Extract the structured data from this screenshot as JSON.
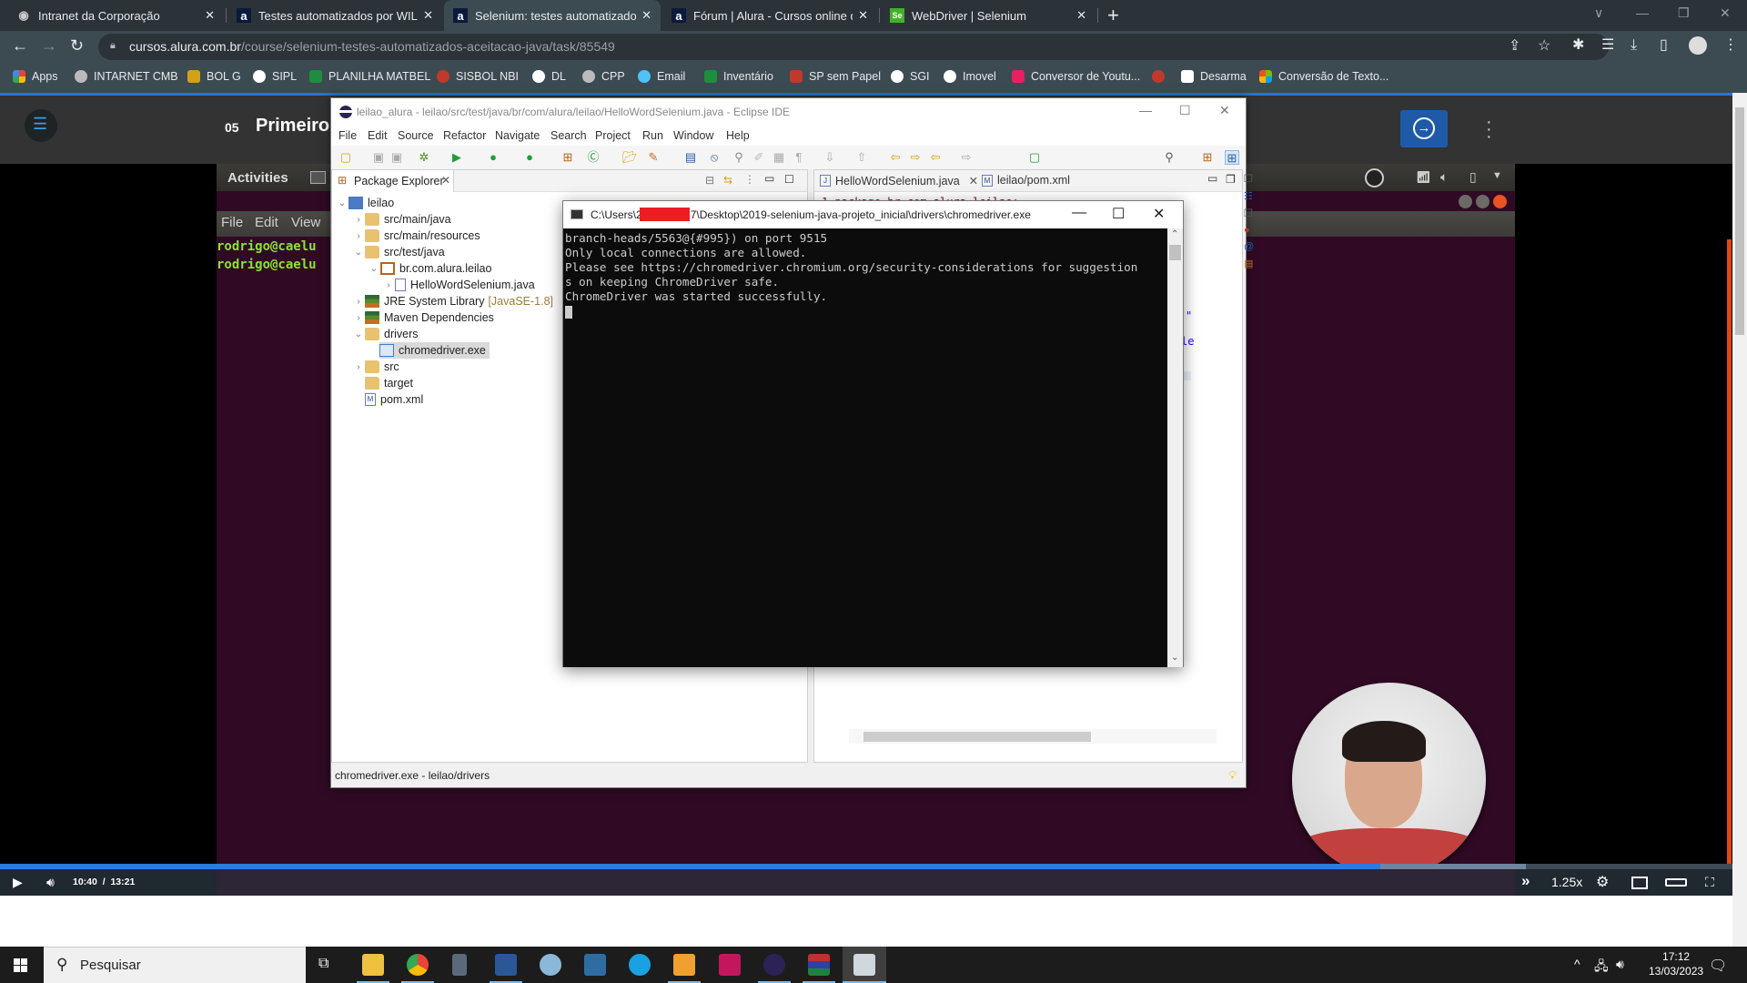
{
  "browser": {
    "tabs": [
      {
        "title": "Intranet da Corporação",
        "icon": "globe-icon"
      },
      {
        "title": "Testes automatizados por WILLIA",
        "icon": "alura-icon"
      },
      {
        "title": "Selenium: testes automatizados d",
        "icon": "alura-icon",
        "active": true
      },
      {
        "title": "Fórum | Alura - Cursos online de",
        "icon": "alura-icon"
      },
      {
        "title": "WebDriver | Selenium",
        "icon": "selenium-icon"
      }
    ],
    "url_host": "cursos.alura.com.br",
    "url_path": "/course/selenium-testes-automatizados-aceitacao-java/task/85549",
    "bookmarks": [
      {
        "label": "Apps",
        "color": "#f4b400"
      },
      {
        "label": "INTARNET CMB",
        "color": "#bbbbbb"
      },
      {
        "label": "BOL G",
        "color": "#d4a017"
      },
      {
        "label": "SIPL",
        "color": "#ffffff"
      },
      {
        "label": "PLANILHA MATBEL",
        "color": "#1e8e3e"
      },
      {
        "label": "SISBOL NBI",
        "color": "#c0392b"
      },
      {
        "label": "DL",
        "color": "#ffffff"
      },
      {
        "label": "CPP",
        "color": "#bbbbbb"
      },
      {
        "label": "Email",
        "color": "#4fc3f7"
      },
      {
        "label": "Inventário",
        "color": "#1e8e3e"
      },
      {
        "label": "SP sem Papel",
        "color": "#c0392b"
      },
      {
        "label": "SGI",
        "color": "#ffffff"
      },
      {
        "label": "Imovel",
        "color": "#ffffff"
      },
      {
        "label": "Conversor de Youtu...",
        "color": "#e91e63"
      },
      {
        "label": "",
        "color": "#c0392b"
      },
      {
        "label": "Desarma",
        "color": "#ffffff"
      },
      {
        "label": "Conversão de Texto...",
        "color": "#f25022"
      }
    ]
  },
  "alura": {
    "lesson_number": "05",
    "lesson_title": "Primeiro",
    "next_icon": "arrow-right-circle-icon",
    "more_icon": "kebab-icon",
    "menu_icon": "menu-arrow-icon"
  },
  "ubuntu": {
    "activities": "Activities",
    "menu": [
      "File",
      "Edit",
      "View"
    ],
    "prompt_lines": [
      "rodrigo@caelu",
      "rodrigo@caelu"
    ]
  },
  "eclipse": {
    "title": "leilao_alura - leilao/src/test/java/br/com/alura/leilao/HelloWordSelenium.java - Eclipse IDE",
    "menu": [
      "File",
      "Edit",
      "Source",
      "Refactor",
      "Navigate",
      "Search",
      "Project",
      "Run",
      "Window",
      "Help"
    ],
    "package_explorer_tab": "Package Explorer",
    "tree": [
      {
        "label": "leilao",
        "level": 0,
        "twisty": "open",
        "icon": "project-icon"
      },
      {
        "label": "src/main/java",
        "level": 1,
        "twisty": "closed",
        "icon": "source-folder-icon"
      },
      {
        "label": "src/main/resources",
        "level": 1,
        "twisty": "closed",
        "icon": "source-folder-icon"
      },
      {
        "label": "src/test/java",
        "level": 1,
        "twisty": "open",
        "icon": "source-folder-icon"
      },
      {
        "label": "br.com.alura.leilao",
        "level": 2,
        "twisty": "open",
        "icon": "package-icon"
      },
      {
        "label": "HelloWordSelenium.java",
        "level": 3,
        "twisty": "closed",
        "icon": "java-file-icon"
      },
      {
        "label": "JRE System Library",
        "decoration": "[JavaSE-1.8]",
        "level": 1,
        "twisty": "closed",
        "icon": "library-icon"
      },
      {
        "label": "Maven Dependencies",
        "level": 1,
        "twisty": "closed",
        "icon": "library-icon"
      },
      {
        "label": "drivers",
        "level": 1,
        "twisty": "open",
        "icon": "folder-icon"
      },
      {
        "label": "chromedriver.exe",
        "level": 2,
        "twisty": "none",
        "icon": "exe-file-icon",
        "selected": true
      },
      {
        "label": "src",
        "level": 1,
        "twisty": "closed",
        "icon": "folder-icon"
      },
      {
        "label": "target",
        "level": 1,
        "twisty": "none",
        "icon": "folder-icon"
      },
      {
        "label": "pom.xml",
        "level": 1,
        "twisty": "none",
        "icon": "maven-file-icon"
      }
    ],
    "editor_tabs": [
      {
        "label": "HelloWordSelenium.java",
        "icon": "java-file-icon",
        "closable": true
      },
      {
        "label": "leilao/pom.xml",
        "icon": "maven-file-icon"
      }
    ],
    "code_line_1": "1  package br.com.alura.leilao;",
    "status": "chromedriver.exe - leilao/drivers"
  },
  "console": {
    "title_prefix": "C:\\Users\\2",
    "title_suffix": "7\\Desktop\\2019-selenium-java-projeto_inicial\\drivers\\chromedriver.exe",
    "lines": [
      "branch-heads/5563@{#995}) on port 9515",
      "Only local connections are allowed.",
      "Please see https://chromedriver.chromium.org/security-considerations for suggestion",
      "s on keeping ChromeDriver safe.",
      "ChromeDriver was started successfully."
    ]
  },
  "player": {
    "current_time": "10:40",
    "separator": "/",
    "duration": "13:21",
    "played_fraction": 0.797,
    "buffered_fraction": 0.881,
    "speed": "1.25x"
  },
  "taskbar": {
    "search_placeholder": "Pesquisar",
    "time": "17:12",
    "date": "13/03/2023",
    "apps": [
      "task-view",
      "file-explorer",
      "chrome",
      "calculator",
      "word",
      "paint",
      "network-app",
      "internet-explorer",
      "outlook",
      "access",
      "eclipse",
      "winrar",
      "console-window"
    ]
  }
}
